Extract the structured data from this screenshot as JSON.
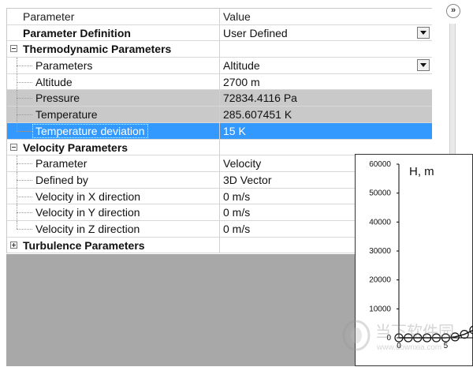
{
  "grid": {
    "header": {
      "col1": "Parameter",
      "col2": "Value"
    },
    "rows": [
      {
        "label": "Parameter Definition",
        "value": "User Defined"
      },
      {
        "label": "Thermodynamic Parameters",
        "value": ""
      },
      {
        "label": "Parameters",
        "value": "Altitude"
      },
      {
        "label": "Altitude",
        "value": "2700 m"
      },
      {
        "label": "Pressure",
        "value": "72834.4116 Pa"
      },
      {
        "label": "Temperature",
        "value": "285.607451 K"
      },
      {
        "label": "Temperature deviation",
        "value": "15 K"
      },
      {
        "label": "Velocity Parameters",
        "value": ""
      },
      {
        "label": "Parameter",
        "value": "Velocity"
      },
      {
        "label": "Defined by",
        "value": "3D Vector"
      },
      {
        "label": "Velocity in X direction",
        "value": "0 m/s"
      },
      {
        "label": "Velocity in Y direction",
        "value": "0 m/s"
      },
      {
        "label": "Velocity in Z direction",
        "value": "0 m/s"
      },
      {
        "label": "Turbulence Parameters",
        "value": ""
      }
    ]
  },
  "panel_toggle_glyph": "»",
  "chart_data": {
    "type": "line",
    "title": "H, m",
    "x_ticks": [
      "0",
      "5"
    ],
    "y_ticks": [
      "0",
      "10000",
      "20000",
      "30000",
      "40000",
      "50000",
      "60000"
    ],
    "ylim": [
      0,
      60000
    ],
    "series": [
      {
        "x": [
          0,
          1,
          2,
          3,
          4,
          5,
          6,
          7,
          8
        ],
        "y": [
          0,
          0,
          0,
          0,
          0,
          0,
          300,
          1200,
          2700
        ]
      }
    ]
  },
  "watermark": {
    "text_cn": "当下软件园",
    "url": "www.downxia.com"
  },
  "colors": {
    "selection": "#3399ff",
    "gray_row": "#c9c9c9",
    "empty_area": "#a8a8a8"
  }
}
